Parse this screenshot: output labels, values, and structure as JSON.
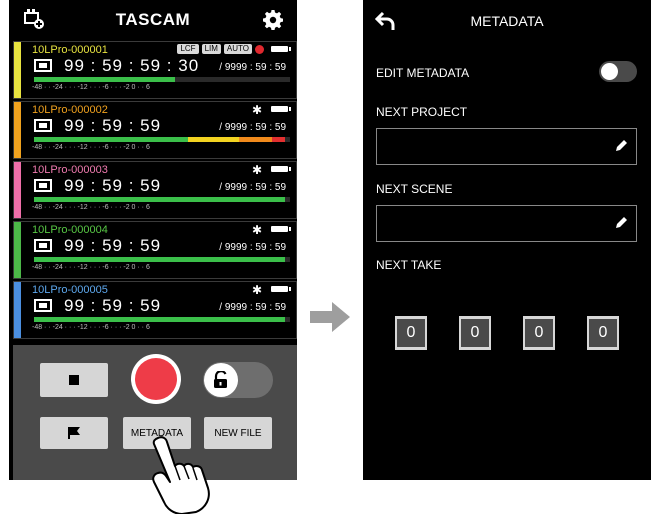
{
  "left_screen": {
    "title": "TASCAM",
    "channels": [
      {
        "name": "10LPro-000001",
        "time": "99 : 59 : 59 : 30",
        "remaining": "/ 9999 : 59 : 59",
        "name_color": "#e8e340",
        "stripe": "#e8e340",
        "badges": [
          "LCF",
          "LIM",
          "AUTO"
        ],
        "recording": true,
        "bluetooth": false,
        "level": 0.55
      },
      {
        "name": "10LPro-000002",
        "time": "99 : 59 : 59",
        "remaining": "/ 9999 : 59 : 59",
        "name_color": "#f0a21e",
        "stripe": "#f0a21e",
        "badges": [],
        "recording": false,
        "bluetooth": true,
        "level": 0.98
      },
      {
        "name": "10LPro-000003",
        "time": "99 : 59 : 59",
        "remaining": "/ 9999 : 59 : 59",
        "name_color": "#f07bb0",
        "stripe": "#ef6fa9",
        "badges": [],
        "recording": false,
        "bluetooth": true,
        "level": 0.98
      },
      {
        "name": "10LPro-000004",
        "time": "99 : 59 : 59",
        "remaining": "/ 9999 : 59 : 59",
        "name_color": "#58c845",
        "stripe": "#4cb848",
        "badges": [],
        "recording": false,
        "bluetooth": true,
        "level": 0.98
      },
      {
        "name": "10LPro-000005",
        "time": "99 : 59 : 59",
        "remaining": "/ 9999 : 59 : 59",
        "name_color": "#5ea8ee",
        "stripe": "#4b8fe0",
        "badges": [],
        "recording": false,
        "bluetooth": true,
        "level": 0.98
      }
    ],
    "meter_scale": "-48 · · -24 · · · -12 · · · -6 · · · -2  0 · · 6",
    "buttons": {
      "metadata": "METADATA",
      "new_file": "NEW FILE"
    }
  },
  "right_screen": {
    "title": "METADATA",
    "edit_metadata_label": "EDIT METADATA",
    "edit_metadata_on": false,
    "next_project_label": "NEXT PROJECT",
    "next_project_value": "",
    "next_scene_label": "NEXT SCENE",
    "next_scene_value": "",
    "next_take_label": "NEXT TAKE",
    "take_digits": [
      "0",
      "0",
      "0",
      "0"
    ]
  },
  "colors": {
    "record_red": "#ee3c48",
    "meter_green": "#3bbf4a",
    "meter_yellow": "#f2d321",
    "meter_orange": "#f08a1c",
    "meter_red": "#e23030"
  }
}
